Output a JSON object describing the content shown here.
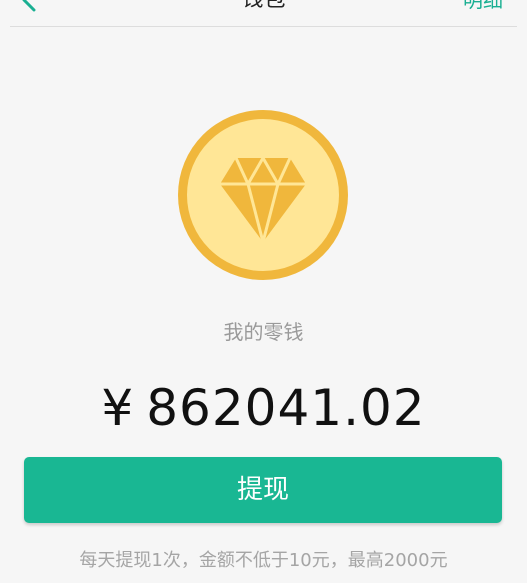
{
  "nav": {
    "title": "钱包",
    "right_label": "明细",
    "back_icon": "back-chevron-icon"
  },
  "wallet": {
    "icon": "diamond-icon",
    "label": "我的零钱",
    "currency_symbol": "¥",
    "amount": "862041.02"
  },
  "actions": {
    "withdraw_label": "提现"
  },
  "notice": {
    "rule_text": "每天提现1次，金额不低于10元，最高2000元"
  },
  "colors": {
    "accent": "#19b793",
    "coin_outer": "#f0b73c",
    "coin_inner": "#ffe696",
    "diamond": "#f0b73c"
  }
}
